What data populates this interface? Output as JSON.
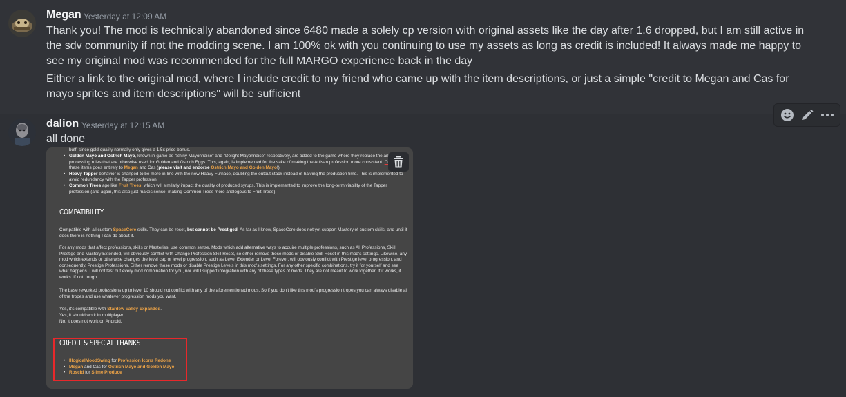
{
  "messages": [
    {
      "author": "Megan",
      "timestamp": "Yesterday at 12:09 AM",
      "paragraphs": [
        "Thank you! The mod is technically abandoned since 6480 made a solely cp version with original assets like the day after 1.6 dropped, but I am still active in the sdv community if not the modding scene. I am 100% ok with you continuing to use my assets as long as credit is included! It always made me happy to see my original mod was recommended for the full MARGO experience back in the day",
        "Either a link to the original mod, where I include credit to my friend who came up with the item descriptions, or just a simple \"credit to Megan and Cas for mayo sprites and item descriptions\" will be sufficient"
      ]
    },
    {
      "author": "dalion",
      "timestamp": "Yesterday at 12:15 AM",
      "text": "all done"
    }
  ],
  "toolbar": {
    "icons": [
      "emoji-icon",
      "pencil-icon",
      "more-icon"
    ]
  },
  "attachment": {
    "top_text": "buff, since gold-quality normally only gives a 1.5x price bonus.",
    "bullets": [
      {
        "lead": "Golden Mayo and Ostrich Mayo",
        "text": ", known in-game as \"Shiny Mayonnaise\" and \"Delight Mayonnaise\" respectively, are added to the game where they replace the arbitrary processing rules that are otherwise used for Golden and Ostrich Eggs. This, again, is implemented for the sake of making the Artisan profession more consistent. ",
        "credit_pre": "Credit for these items goes entirely to ",
        "credit_name": "Megan",
        "credit_mid": " and Cas (",
        "credit_bold": "please visit and endorse ",
        "credit_link": "Ostrich Mayo and Golden Mayo",
        "credit_end": "!)."
      },
      {
        "lead": "Heavy Tapper",
        "text": " behavior is changed to be more in-line with the new Heavy Furnace, doubling the output stack instead of halving the production time. This is implemented to avoid redundancy with the Tapper profession."
      },
      {
        "lead": "Common Trees",
        "text": " age like ",
        "link": "Fruit Trees",
        "text2": ", which will similarly impact the quality of produced syrups. This is implemented to improve the long-term viability of the Tapper profession (and again, this also just makes sense, making Common Trees more analogous to Fruit Trees)."
      }
    ],
    "compat_heading": "COMPATIBILITY",
    "compat_p1_a": "Compatible with all custom ",
    "compat_p1_link": "SpaceCore",
    "compat_p1_b": " skills. They can be reset, ",
    "compat_p1_bold": "but cannot be Prestiged",
    "compat_p1_c": ". As far as I know, SpaceCore does not yet support Mastery of custom skills, and until it does there is nothing I can do about it.",
    "compat_p2": "For any mods that affect professions, skills or Masteries, use common sense. Mods which add alternative ways to acquire multiple professions, such as All Professions, Skill Prestige and Mastery Extended, will obviously conflict with Change Profession Skill Reset, so either remove those mods or disable Skill Reset in this mod's settings. Likewise, any mod which extends or otherwise changes the level cap or level progression, such as Level Extender or Level Forever, will obviously conflict with Prestige level progression, and consequently, Prestige Professions. Either remove those mods or disable Prestige Levels in this mod's settings. For any other specific combinations, try it for yourself and see what happens. I will not test out every mod combination for you, nor will I support integration with any of these types of mods. They are not meant to work together. If it works, it works. If not, tough.",
    "compat_p3": "The base reworked professions up to level 10 should not conflict with any of the aforementioned mods. So if you don't like this mod's progression tropes you can always disable all of the tropes and use whatever progression mods you want.",
    "compat_p4_a": "Yes, it's compatible with ",
    "compat_p4_link": "Stardew Valley Expanded",
    "compat_p4_b": ".",
    "compat_p5": "Yes, it should work in multiplayer.",
    "compat_p6": "No, it does not work on Android.",
    "credit_heading": "CREDIT & SPECIAL THANKS",
    "credits": [
      {
        "who": "IllogicalMoodSwing",
        "for": " for ",
        "what": "Profession Icons Redone"
      },
      {
        "who": "Megan",
        "mid": " and Cas for ",
        "what": "Ostrich Mayo and Golden Mayo"
      },
      {
        "who": "Roscid",
        "for": " for ",
        "what": "Slime Produce"
      }
    ]
  }
}
